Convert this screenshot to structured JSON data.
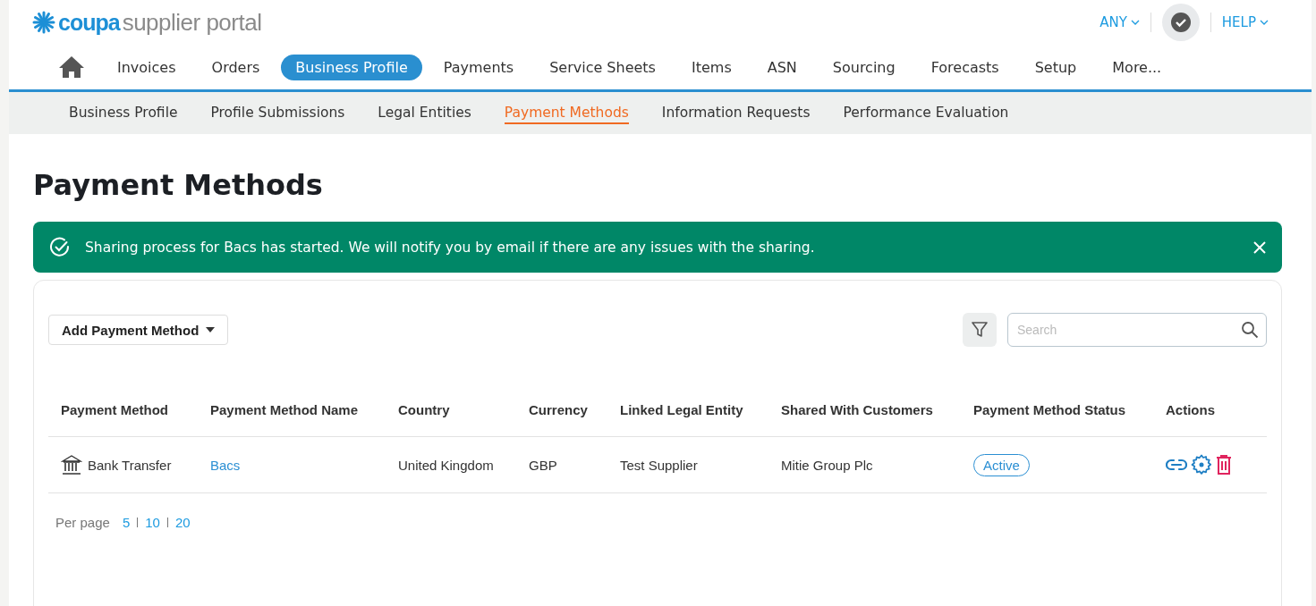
{
  "header": {
    "logo": {
      "brand": "coupa",
      "product": "supplier portal"
    },
    "account_menu": "ANY",
    "help_menu": "HELP"
  },
  "nav": {
    "items": [
      {
        "label": "Invoices",
        "selected": false
      },
      {
        "label": "Orders",
        "selected": false
      },
      {
        "label": "Business Profile",
        "selected": true
      },
      {
        "label": "Payments",
        "selected": false
      },
      {
        "label": "Service Sheets",
        "selected": false
      },
      {
        "label": "Items",
        "selected": false
      },
      {
        "label": "ASN",
        "selected": false
      },
      {
        "label": "Sourcing",
        "selected": false
      },
      {
        "label": "Forecasts",
        "selected": false
      },
      {
        "label": "Setup",
        "selected": false
      },
      {
        "label": "More...",
        "selected": false
      }
    ]
  },
  "subnav": {
    "items": [
      {
        "label": "Business Profile",
        "selected": false
      },
      {
        "label": "Profile Submissions",
        "selected": false
      },
      {
        "label": "Legal Entities",
        "selected": false
      },
      {
        "label": "Payment Methods",
        "selected": true
      },
      {
        "label": "Information Requests",
        "selected": false
      },
      {
        "label": "Performance Evaluation",
        "selected": false
      }
    ]
  },
  "page_title": "Payment Methods",
  "banner": {
    "message": "Sharing process for Bacs has started. We will notify you by email if there are any issues with the sharing."
  },
  "toolbar": {
    "add_button": "Add Payment Method",
    "search": {
      "placeholder": "Search"
    }
  },
  "table": {
    "columns": [
      "Payment Method",
      "Payment Method Name",
      "Country",
      "Currency",
      "Linked Legal Entity",
      "Shared With Customers",
      "Payment Method Status",
      "Actions"
    ],
    "rows": [
      {
        "payment_method": "Bank Transfer",
        "name": "Bacs",
        "country": "United Kingdom",
        "currency": "GBP",
        "legal_entity": "Test Supplier",
        "shared_with": "Mitie Group Plc",
        "status": "Active"
      }
    ]
  },
  "pagination": {
    "label": "Per page",
    "options": [
      "5",
      "10",
      "20"
    ]
  }
}
